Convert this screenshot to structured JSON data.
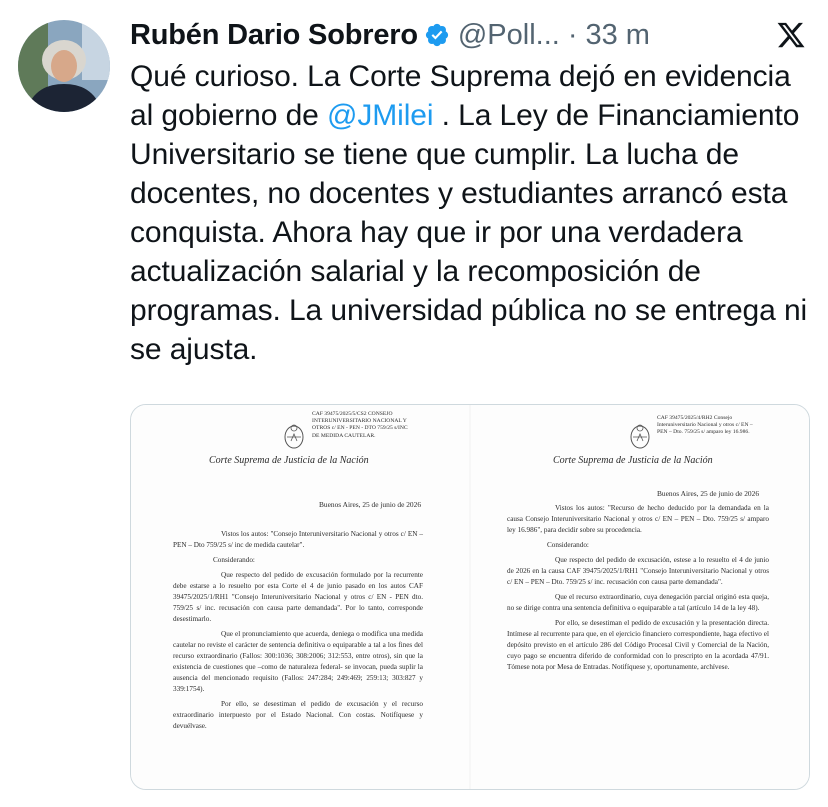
{
  "tweet": {
    "author_name": "Rubén Dario Sobrero",
    "handle": "@Poll...",
    "separator": "·",
    "time": "33 m",
    "text_part1": "Qué curioso. La Corte Suprema dejó en evidencia al gobierno de ",
    "mention": "@JMilei",
    "text_part2": " . La Ley de Financiamiento Universitario se tiene que cumplir. La lucha de docentes, no docentes y estudiantes arrancó esta conquista. Ahora hay que ir por una verdadera actualización salarial y la recomposición de programas. La universidad pública no se entrega ni se ajusta.",
    "colors": {
      "accent": "#1d9bf0",
      "verified": "#1d9bf0",
      "muted": "#536471"
    },
    "icons": [
      "verified-badge-icon",
      "x-logo-icon"
    ]
  },
  "documents": {
    "left": {
      "case_ref": "CAF 39475/2025/5/CS2 CONSEJO INTERUNIVERSITARIO NACIONAL Y OTROS c/ EN - PEN - DTO 759/25 s/INC DE MEDIDA CAUTELAR.",
      "court": "Corte Suprema de Justicia de la Nación",
      "date": "Buenos Aires, 25 de junio de 2026",
      "p1": "Vistos los autos: \"Consejo Interuniversitario Nacional y otros c/ EN – PEN – Dto 759/25 s/ inc de medida cautelar\".",
      "p2": "Considerando:",
      "p3": "Que respecto del pedido de excusación formulado por la recurrente debe estarse a lo resuelto por esta Corte el 4 de junio pasado en los autos CAF 39475/2025/1/RH1 \"Consejo Interuniversitario Nacional y otros c/ EN - PEN dto. 759/25 s/ inc. recusación con causa parte demandada\". Por lo tanto, corresponde desestimarlo.",
      "p4": "Que el pronunciamiento que acuerda, deniega o modifica una medida cautelar no reviste el carácter de sentencia definitiva o equiparable a tal a los fines del recurso extraordinario (Fallos: 300:1036; 308:2006; 312:553, entre otros), sin que la existencia de cuestiones que –como de naturaleza federal- se invocan, pueda suplir la ausencia del mencionado requisito (Fallos: 247:284; 249:469; 259:13; 303:827 y 339:1754).",
      "p5": "Por ello, se desestiman el pedido de excusación y el recurso extraordinario interpuesto por el Estado Nacional. Con costas. Notifíquese y devuélvase."
    },
    "right": {
      "case_ref": "CAF 39475/2025/4/RH2 Consejo Interuniversitario Nacional y otros c/ EN – PEN – Dto. 759/25 s/ amparo ley 16.986.",
      "court": "Corte Suprema de Justicia de la Nación",
      "date": "Buenos Aires, 25 de junio de 2026",
      "p1": "Vistos los autos: \"Recurso de hecho deducido por la demandada en la causa Consejo Interuniversitario Nacional y otros c/ EN – PEN – Dto. 759/25 s/ amparo ley 16.986\", para decidir sobre su procedencia.",
      "p2": "Considerando:",
      "p3": "Que respecto del pedido de excusación, estese a lo resuelto el 4 de junio de 2026 en la causa CAF 39475/2025/1/RH1 \"Consejo Interuniversitario Nacional y otros c/ EN – PEN – Dto. 759/25 s/ inc. recusación con causa parte demandada\".",
      "p4": "Que el recurso extraordinario, cuya denegación parcial originó esta queja, no se dirige contra una sentencia definitiva o equiparable a tal (artículo 14 de la ley 48).",
      "p5": "Por ello, se desestiman el pedido de excusación y la presentación directa. Intímese al recurrente para que, en el ejercicio financiero correspondiente, haga efectivo el depósito previsto en el artículo 286 del Código Procesal Civil y Comercial de la Nación, cuyo pago se encuentra diferido de conformidad con lo prescripto en la acordada 47/91. Tómese nota por Mesa de Entradas. Notifíquese y, oportunamente, archívese."
    }
  }
}
